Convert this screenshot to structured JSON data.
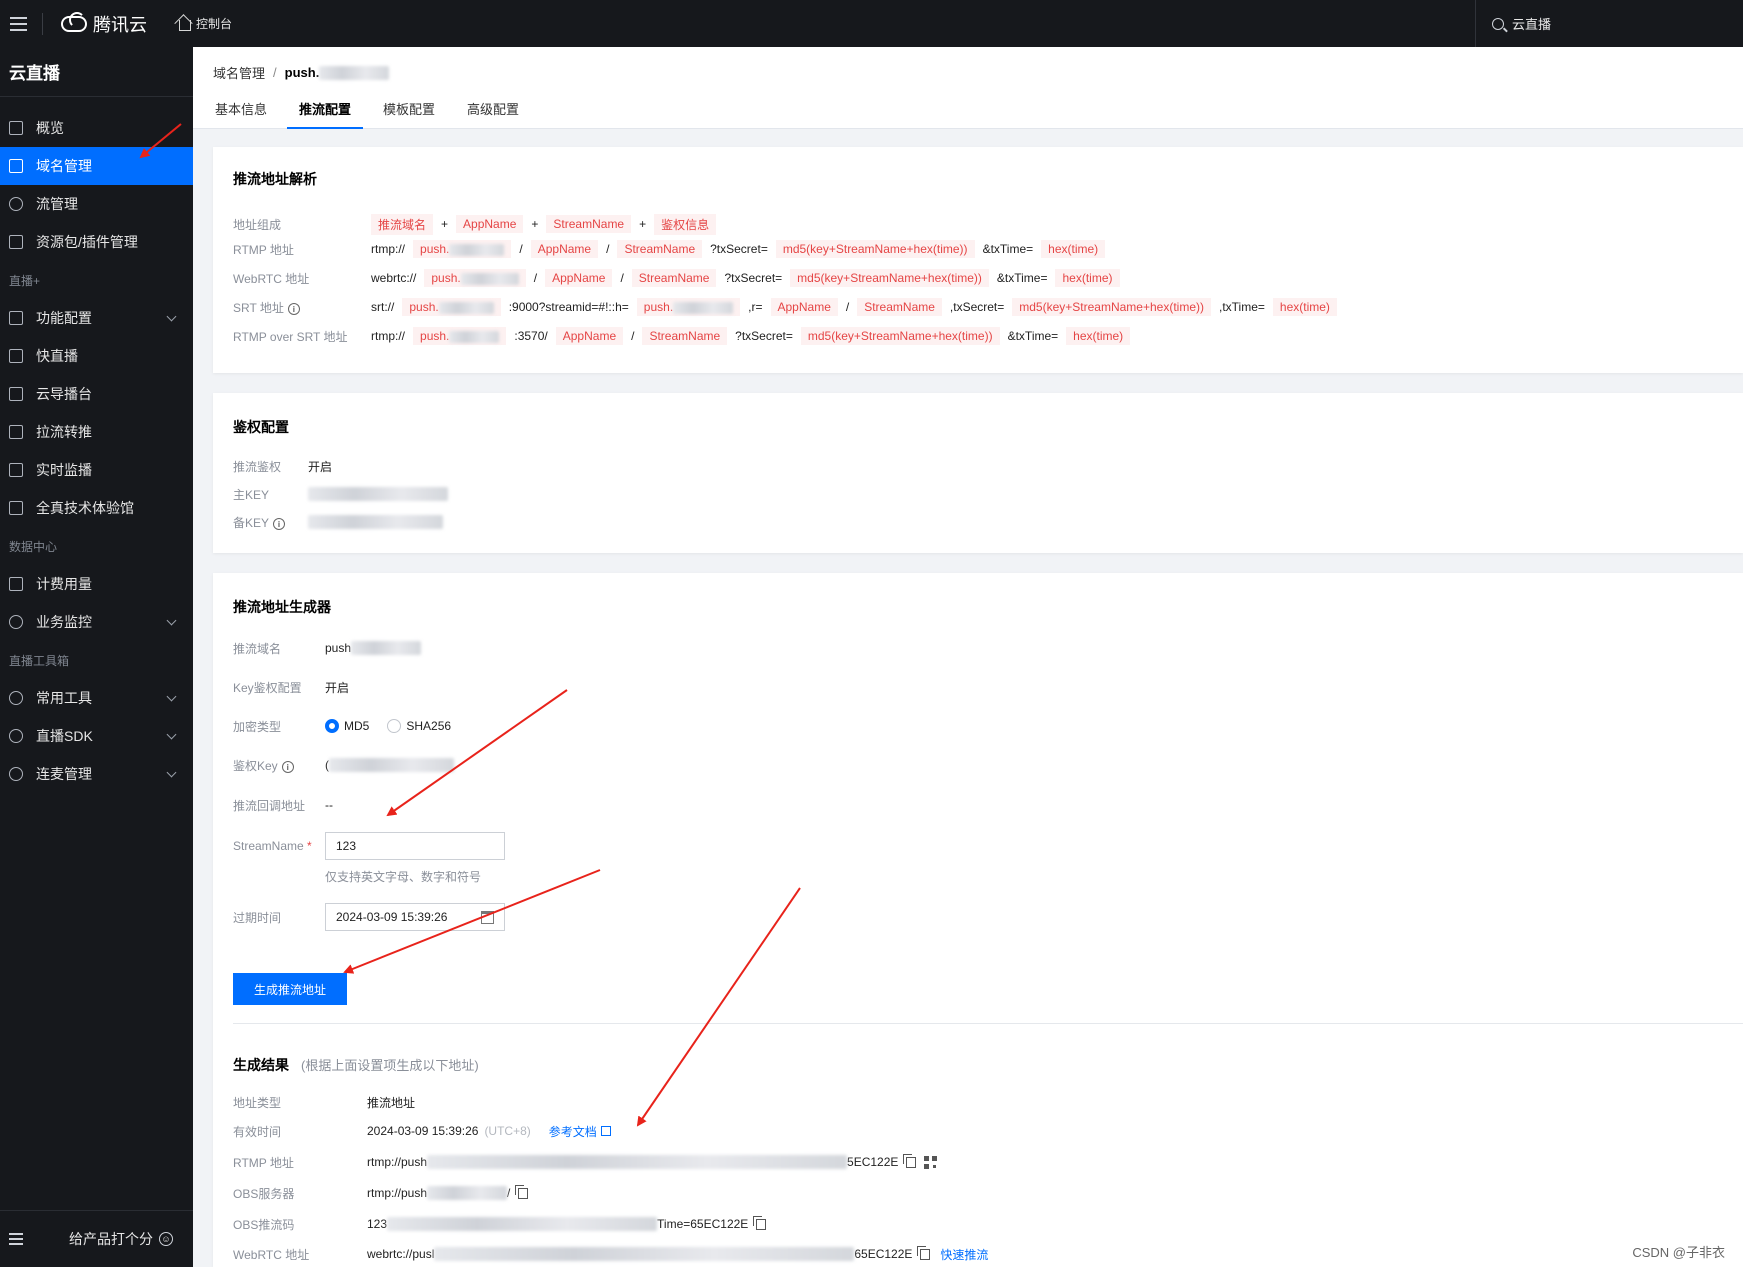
{
  "topbar": {
    "brand": "腾讯云",
    "console": "控制台",
    "search": "云直播"
  },
  "sidebar": {
    "title": "云直播",
    "items": [
      {
        "label": "概览"
      },
      {
        "label": "域名管理"
      },
      {
        "label": "流管理"
      },
      {
        "label": "资源包/插件管理"
      },
      {
        "group": "直播+"
      },
      {
        "label": "功能配置"
      },
      {
        "label": "快直播"
      },
      {
        "label": "云导播台"
      },
      {
        "label": "拉流转推"
      },
      {
        "label": "实时监播"
      },
      {
        "label": "全真技术体验馆"
      },
      {
        "group": "数据中心"
      },
      {
        "label": "计费用量"
      },
      {
        "label": "业务监控"
      },
      {
        "group": "直播工具箱"
      },
      {
        "label": "常用工具"
      },
      {
        "label": "直播SDK"
      },
      {
        "label": "连麦管理"
      }
    ],
    "rate": "给产品打个分"
  },
  "header": {
    "breadcrumb_root": "域名管理",
    "breadcrumb_current": "push.",
    "tabs": [
      "基本信息",
      "推流配置",
      "模板配置",
      "高级配置"
    ]
  },
  "parse": {
    "title": "推流地址解析",
    "labels": [
      "地址组成",
      "RTMP 地址",
      "WebRTC 地址",
      "SRT 地址",
      "RTMP over SRT 地址"
    ],
    "compose": {
      "domain": "推流域名",
      "plus": "+",
      "app": "AppName",
      "stream": "StreamName",
      "auth": "鉴权信息"
    },
    "rtmp": {
      "prefix": "rtmp://",
      "domain": "push.",
      "slash": "/",
      "app": "AppName",
      "stream": "StreamName",
      "secret": "?txSecret=",
      "md5": "md5(key+StreamName+hex(time))",
      "time": "&txTime=",
      "hex": "hex(time)"
    },
    "webrtc": {
      "prefix": "webrtc://",
      "domain": "push."
    },
    "srt": {
      "prefix": "srt://",
      "domain": "push.",
      "port": ":9000?streamid=#!::h=",
      "domain2": "push.",
      "r": ",r=",
      "secret": ",txSecret=",
      "time": ",txTime="
    },
    "rtmpsrt": {
      "prefix": "rtmp://",
      "domain": "push.",
      "port": ":3570/"
    }
  },
  "auth": {
    "title": "鉴权配置",
    "labels": [
      "推流鉴权",
      "主KEY",
      "备KEY"
    ],
    "enabled": "开启"
  },
  "generator": {
    "title": "推流地址生成器",
    "labels": [
      "推流域名",
      "Key鉴权配置",
      "加密类型",
      "鉴权Key",
      "推流回调地址",
      "StreamName",
      "过期时间"
    ],
    "domain": "push",
    "key_auth": "开启",
    "md5": "MD5",
    "sha": "SHA256",
    "auth_key_prefix": "(",
    "callback": "--",
    "stream_name": "123",
    "stream_hint": "仅支持英文字母、数字和符号",
    "expire": "2024-03-09 15:39:26",
    "button": "生成推流地址"
  },
  "result": {
    "title": "生成结果",
    "note": "(根据上面设置项生成以下地址)",
    "labels": [
      "地址类型",
      "有效时间",
      "RTMP 地址",
      "OBS服务器",
      "OBS推流码",
      "WebRTC 地址"
    ],
    "type": "推流地址",
    "valid_time": "2024-03-09 15:39:26",
    "utc": "(UTC+8)",
    "doc_link": "参考文档",
    "rtmp_start": "rtmp://push",
    "rtmp_end": "5EC122E",
    "obs_server_start": "rtmp://push",
    "obs_server_end": "/",
    "obs_code_start": "123",
    "obs_code_end": "Time=65EC122E",
    "webrtc_start": "webrtc://pusl",
    "webrtc_end": "65EC122E",
    "quick_push": "快速推流"
  },
  "watermark": "CSDN @子非衣",
  "colors": {
    "accent": "#006eff",
    "tag_text": "#e54545",
    "tag_bg": "#fdf1f1",
    "arrow": "#e8231b"
  }
}
